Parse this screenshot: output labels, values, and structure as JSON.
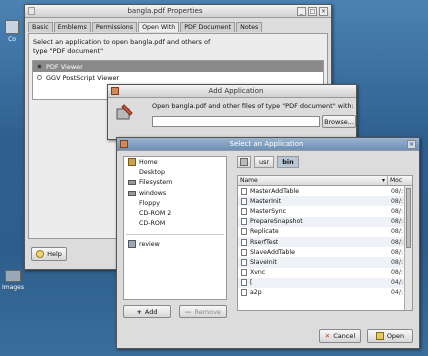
{
  "desktop": {
    "icon_labels": [
      "Co",
      "Images"
    ]
  },
  "properties_window": {
    "title": "bangla.pdf Properties",
    "tabs": [
      "Basic",
      "Emblems",
      "Permissions",
      "Open With",
      "PDF Document",
      "Notes"
    ],
    "selected_tab": "Open With",
    "description": "Select an application to open bangla.pdf and others of type \"PDF document\"",
    "apps": [
      {
        "label": "PDF Viewer",
        "selected": true
      },
      {
        "label": "GGV PostScript Viewer",
        "selected": false
      }
    ],
    "help_label": "Help"
  },
  "add_application": {
    "title": "Add Application",
    "prompt": "Open bangla.pdf and other files of type \"PDF document\" with:",
    "command_value": "",
    "browse_label": "Browse..."
  },
  "select_application": {
    "title": "Select an Application",
    "places": [
      {
        "label": "Home",
        "icon": "home-icon"
      },
      {
        "label": "Desktop",
        "icon": ""
      },
      {
        "label": "Filesystem",
        "icon": "drive-icon"
      },
      {
        "label": "windows",
        "icon": "drive-icon"
      },
      {
        "label": "Floppy",
        "icon": ""
      },
      {
        "label": "CD-ROM 2",
        "icon": ""
      },
      {
        "label": "CD-ROM",
        "icon": ""
      },
      {
        "label": "review",
        "icon": "folder-icon"
      }
    ],
    "path": [
      "usr",
      "bin"
    ],
    "selected_path": "bin",
    "columns": {
      "name": "Name",
      "modified": "Moc"
    },
    "files": [
      {
        "name": "MasterAddTable",
        "modified": "08/:"
      },
      {
        "name": "MasterInit",
        "modified": "08/:"
      },
      {
        "name": "MasterSync",
        "modified": "08/:"
      },
      {
        "name": "PrepareSnapshot",
        "modified": "08/:"
      },
      {
        "name": "Replicate",
        "modified": "08/:"
      },
      {
        "name": "RserfTest",
        "modified": "08/:"
      },
      {
        "name": "SlaveAddTable",
        "modified": "08/:"
      },
      {
        "name": "SlaveInit",
        "modified": "08/:"
      },
      {
        "name": "Xvnc",
        "modified": "08/:"
      },
      {
        "name": "[",
        "modified": "04/:"
      },
      {
        "name": "a2p",
        "modified": "04/:"
      }
    ],
    "add_label": "Add",
    "remove_label": "Remove",
    "cancel_label": "Cancel",
    "open_label": "Open"
  }
}
